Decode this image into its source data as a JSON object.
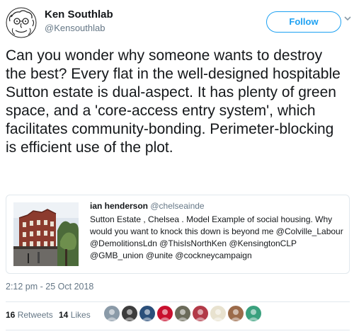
{
  "author": {
    "display_name": "Ken Southlab",
    "handle": "@Kensouthlab"
  },
  "follow_button": {
    "label": "Follow"
  },
  "tweet": {
    "text": "Can you wonder why someone wants to destroy the best? Every flat in the well-designed hospitable Sutton estate is dual-aspect. It has plenty of green space, and a 'core-access entry system', which facilitates community-bonding. Perimeter-blocking is efficient use of the plot."
  },
  "quoted_tweet": {
    "display_name": "ian henderson",
    "handle": "@chelseainde",
    "text": "Sutton Estate , Chelsea . Model Example of social housing. Why would you want to knock this down is beyond me @Colville_Labour @DemolitionsLdn @ThisIsNorthKen @KensingtonCLP @GMB_union @unite @cockneycampaign"
  },
  "timestamp": "2:12 pm - 25 Oct 2018",
  "stats": {
    "retweets_count": "16",
    "retweets_label": "Retweets",
    "likes_count": "14",
    "likes_label": "Likes"
  },
  "likers": [
    {
      "icon": "liker-avatar-1",
      "color": "#8a9aa8"
    },
    {
      "icon": "liker-avatar-2",
      "color": "#3d3d3d"
    },
    {
      "icon": "liker-avatar-3",
      "color": "#2b4f7a"
    },
    {
      "icon": "liker-avatar-4",
      "color": "#c8102e"
    },
    {
      "icon": "liker-avatar-5",
      "color": "#6b6b5a"
    },
    {
      "icon": "liker-avatar-6",
      "color": "#b23a48"
    },
    {
      "icon": "liker-avatar-7",
      "color": "#e8e2cf"
    },
    {
      "icon": "liker-avatar-8",
      "color": "#9c6b4a"
    },
    {
      "icon": "liker-avatar-9",
      "color": "#3aa17e"
    }
  ],
  "colors": {
    "accent": "#1da1f2",
    "secondary_text": "#657786",
    "border": "#e1e8ed"
  }
}
